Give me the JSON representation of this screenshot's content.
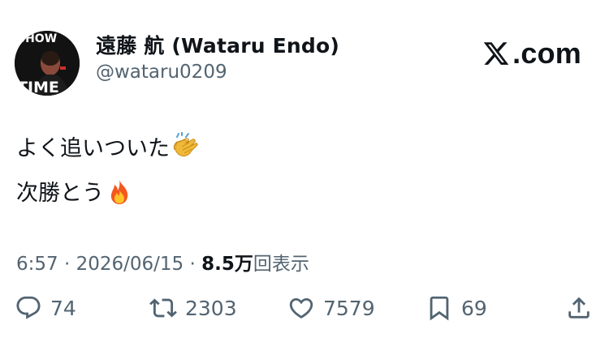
{
  "author": {
    "display_name": "遠藤 航 (Wataru Endo)",
    "handle": "@wataru0209",
    "avatar_text_top": "SHOW",
    "avatar_text_bottom": "TIME"
  },
  "brand": {
    "name": "X.com",
    "label": ".com"
  },
  "tweet": {
    "line1": "よく追いついた",
    "line1_emoji": "clapping-hands",
    "line2": "次勝とう",
    "line2_emoji": "fire"
  },
  "meta": {
    "time": "6:57",
    "separator": "·",
    "date": "2026/06/15",
    "views_count": "8.5",
    "views_unit": "万",
    "views_label": "回表示"
  },
  "actions": {
    "replies": "74",
    "reposts": "2303",
    "likes": "7579",
    "bookmarks": "69"
  },
  "colors": {
    "text": "#0f1419",
    "secondary": "#536471",
    "background": "#ffffff"
  }
}
